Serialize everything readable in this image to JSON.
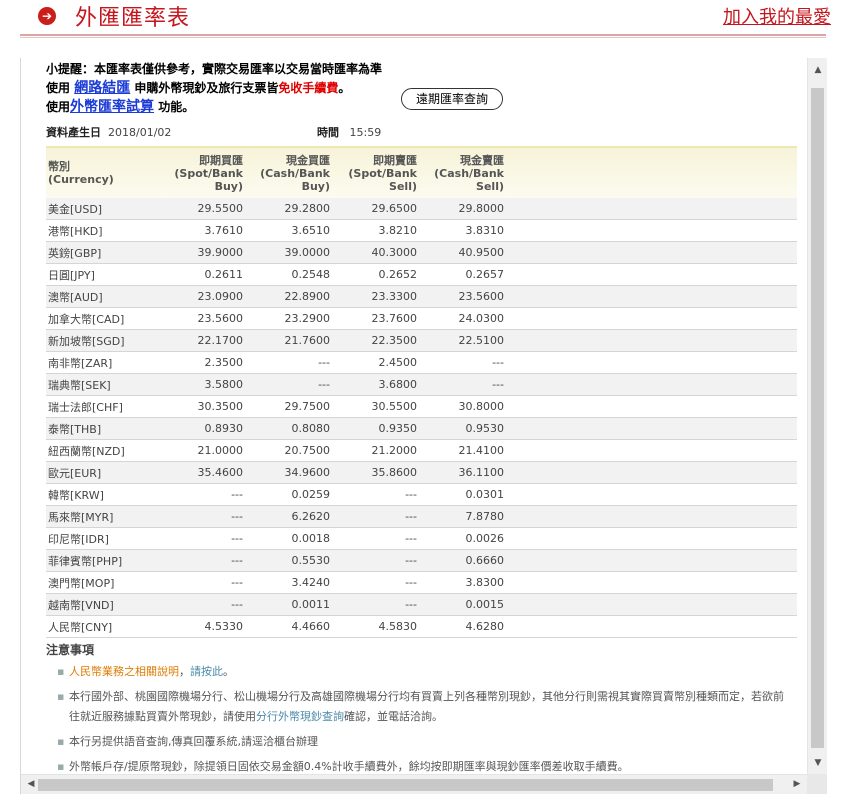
{
  "header": {
    "title": "外匯匯率表",
    "favorite_link": "加入我的最愛",
    "icon": "circle-arrow-right-icon"
  },
  "notice": {
    "line1": "小提醒：本匯率表僅供參考，實際交易匯率以交易當時匯率為準",
    "line2_prefix": "使用",
    "line2_link": "網路結匯",
    "line2_mid": "申購外幣現鈔及旅行支票皆",
    "line2_red": "免收手續費",
    "line2_end": "。",
    "line3_prefix": "使用",
    "line3_link": "外幣匯率試算",
    "line3_suffix": "功能。",
    "forward_button": "遠期匯率查詢"
  },
  "meta": {
    "date_label": "資料產生日",
    "date_value": "2018/01/02",
    "time_label": "時間",
    "time_value": "15:59"
  },
  "table": {
    "headers": {
      "currency": [
        "幣別",
        "(Currency)"
      ],
      "spot_buy": [
        "即期買匯",
        "(Spot/Bank",
        "Buy)"
      ],
      "cash_buy": [
        "現金買匯",
        "(Cash/Bank",
        "Buy)"
      ],
      "spot_sell": [
        "即期賣匯",
        "(Spot/Bank",
        "Sell)"
      ],
      "cash_sell": [
        "現金賣匯",
        "(Cash/Bank",
        "Sell)"
      ]
    },
    "rows": [
      {
        "currency": "美金[USD]",
        "spot_buy": "29.5500",
        "cash_buy": "29.2800",
        "spot_sell": "29.6500",
        "cash_sell": "29.8000"
      },
      {
        "currency": "港幣[HKD]",
        "spot_buy": "3.7610",
        "cash_buy": "3.6510",
        "spot_sell": "3.8210",
        "cash_sell": "3.8310"
      },
      {
        "currency": "英鎊[GBP]",
        "spot_buy": "39.9000",
        "cash_buy": "39.0000",
        "spot_sell": "40.3000",
        "cash_sell": "40.9500"
      },
      {
        "currency": "日圓[JPY]",
        "spot_buy": "0.2611",
        "cash_buy": "0.2548",
        "spot_sell": "0.2652",
        "cash_sell": "0.2657"
      },
      {
        "currency": "澳幣[AUD]",
        "spot_buy": "23.0900",
        "cash_buy": "22.8900",
        "spot_sell": "23.3300",
        "cash_sell": "23.5600"
      },
      {
        "currency": "加拿大幣[CAD]",
        "spot_buy": "23.5600",
        "cash_buy": "23.2900",
        "spot_sell": "23.7600",
        "cash_sell": "24.0300"
      },
      {
        "currency": "新加坡幣[SGD]",
        "spot_buy": "22.1700",
        "cash_buy": "21.7600",
        "spot_sell": "22.3500",
        "cash_sell": "22.5100"
      },
      {
        "currency": "南非幣[ZAR]",
        "spot_buy": "2.3500",
        "cash_buy": "---",
        "spot_sell": "2.4500",
        "cash_sell": "---"
      },
      {
        "currency": "瑞典幣[SEK]",
        "spot_buy": "3.5800",
        "cash_buy": "---",
        "spot_sell": "3.6800",
        "cash_sell": "---"
      },
      {
        "currency": "瑞士法郎[CHF]",
        "spot_buy": "30.3500",
        "cash_buy": "29.7500",
        "spot_sell": "30.5500",
        "cash_sell": "30.8000"
      },
      {
        "currency": "泰幣[THB]",
        "spot_buy": "0.8930",
        "cash_buy": "0.8080",
        "spot_sell": "0.9350",
        "cash_sell": "0.9530"
      },
      {
        "currency": "紐西蘭幣[NZD]",
        "spot_buy": "21.0000",
        "cash_buy": "20.7500",
        "spot_sell": "21.2000",
        "cash_sell": "21.4100"
      },
      {
        "currency": "歐元[EUR]",
        "spot_buy": "35.4600",
        "cash_buy": "34.9600",
        "spot_sell": "35.8600",
        "cash_sell": "36.1100"
      },
      {
        "currency": "韓幣[KRW]",
        "spot_buy": "---",
        "cash_buy": "0.0259",
        "spot_sell": "---",
        "cash_sell": "0.0301"
      },
      {
        "currency": "馬來幣[MYR]",
        "spot_buy": "---",
        "cash_buy": "6.2620",
        "spot_sell": "---",
        "cash_sell": "7.8780"
      },
      {
        "currency": "印尼幣[IDR]",
        "spot_buy": "---",
        "cash_buy": "0.0018",
        "spot_sell": "---",
        "cash_sell": "0.0026"
      },
      {
        "currency": "菲律賓幣[PHP]",
        "spot_buy": "---",
        "cash_buy": "0.5530",
        "spot_sell": "---",
        "cash_sell": "0.6660"
      },
      {
        "currency": "澳門幣[MOP]",
        "spot_buy": "---",
        "cash_buy": "3.4240",
        "spot_sell": "---",
        "cash_sell": "3.8300"
      },
      {
        "currency": "越南幣[VND]",
        "spot_buy": "---",
        "cash_buy": "0.0011",
        "spot_sell": "---",
        "cash_sell": "0.0015"
      },
      {
        "currency": "人民幣[CNY]",
        "spot_buy": "4.5330",
        "cash_buy": "4.4660",
        "spot_sell": "4.5830",
        "cash_sell": "4.6280"
      }
    ]
  },
  "notes": {
    "title": "注意事項",
    "item1_link": "人民幣業務之相關說明",
    "item1_sep": "，",
    "item1_click": "請按此",
    "item1_end": "。",
    "item2_a": "本行國外部、桃園國際機場分行、松山機場分行及高雄國際機場分行均有買賣上列各種幣別現鈔，其他分行則需視其實際買賣幣別種類而定，若欲前往就近服務據點買賣外幣現鈔，請使用",
    "item2_link": "分行外幣現鈔查詢",
    "item2_b": "確認，並電話洽詢。",
    "item3": "本行另提供語音查詢,傳真回覆系統,請逕洽櫃台辦理",
    "item4": "外幣帳戶存/提原幣現鈔，除提領日固依交易金額0.4%計收手續費外，餘均按即期匯率與現鈔匯率價差收取手續費。"
  },
  "colors": {
    "brand_red": "#c4161c",
    "link_blue": "#1a3bd6",
    "notice_red": "#e00000",
    "note_orange": "#dd7b00",
    "note_teal": "#4a8aa8"
  }
}
